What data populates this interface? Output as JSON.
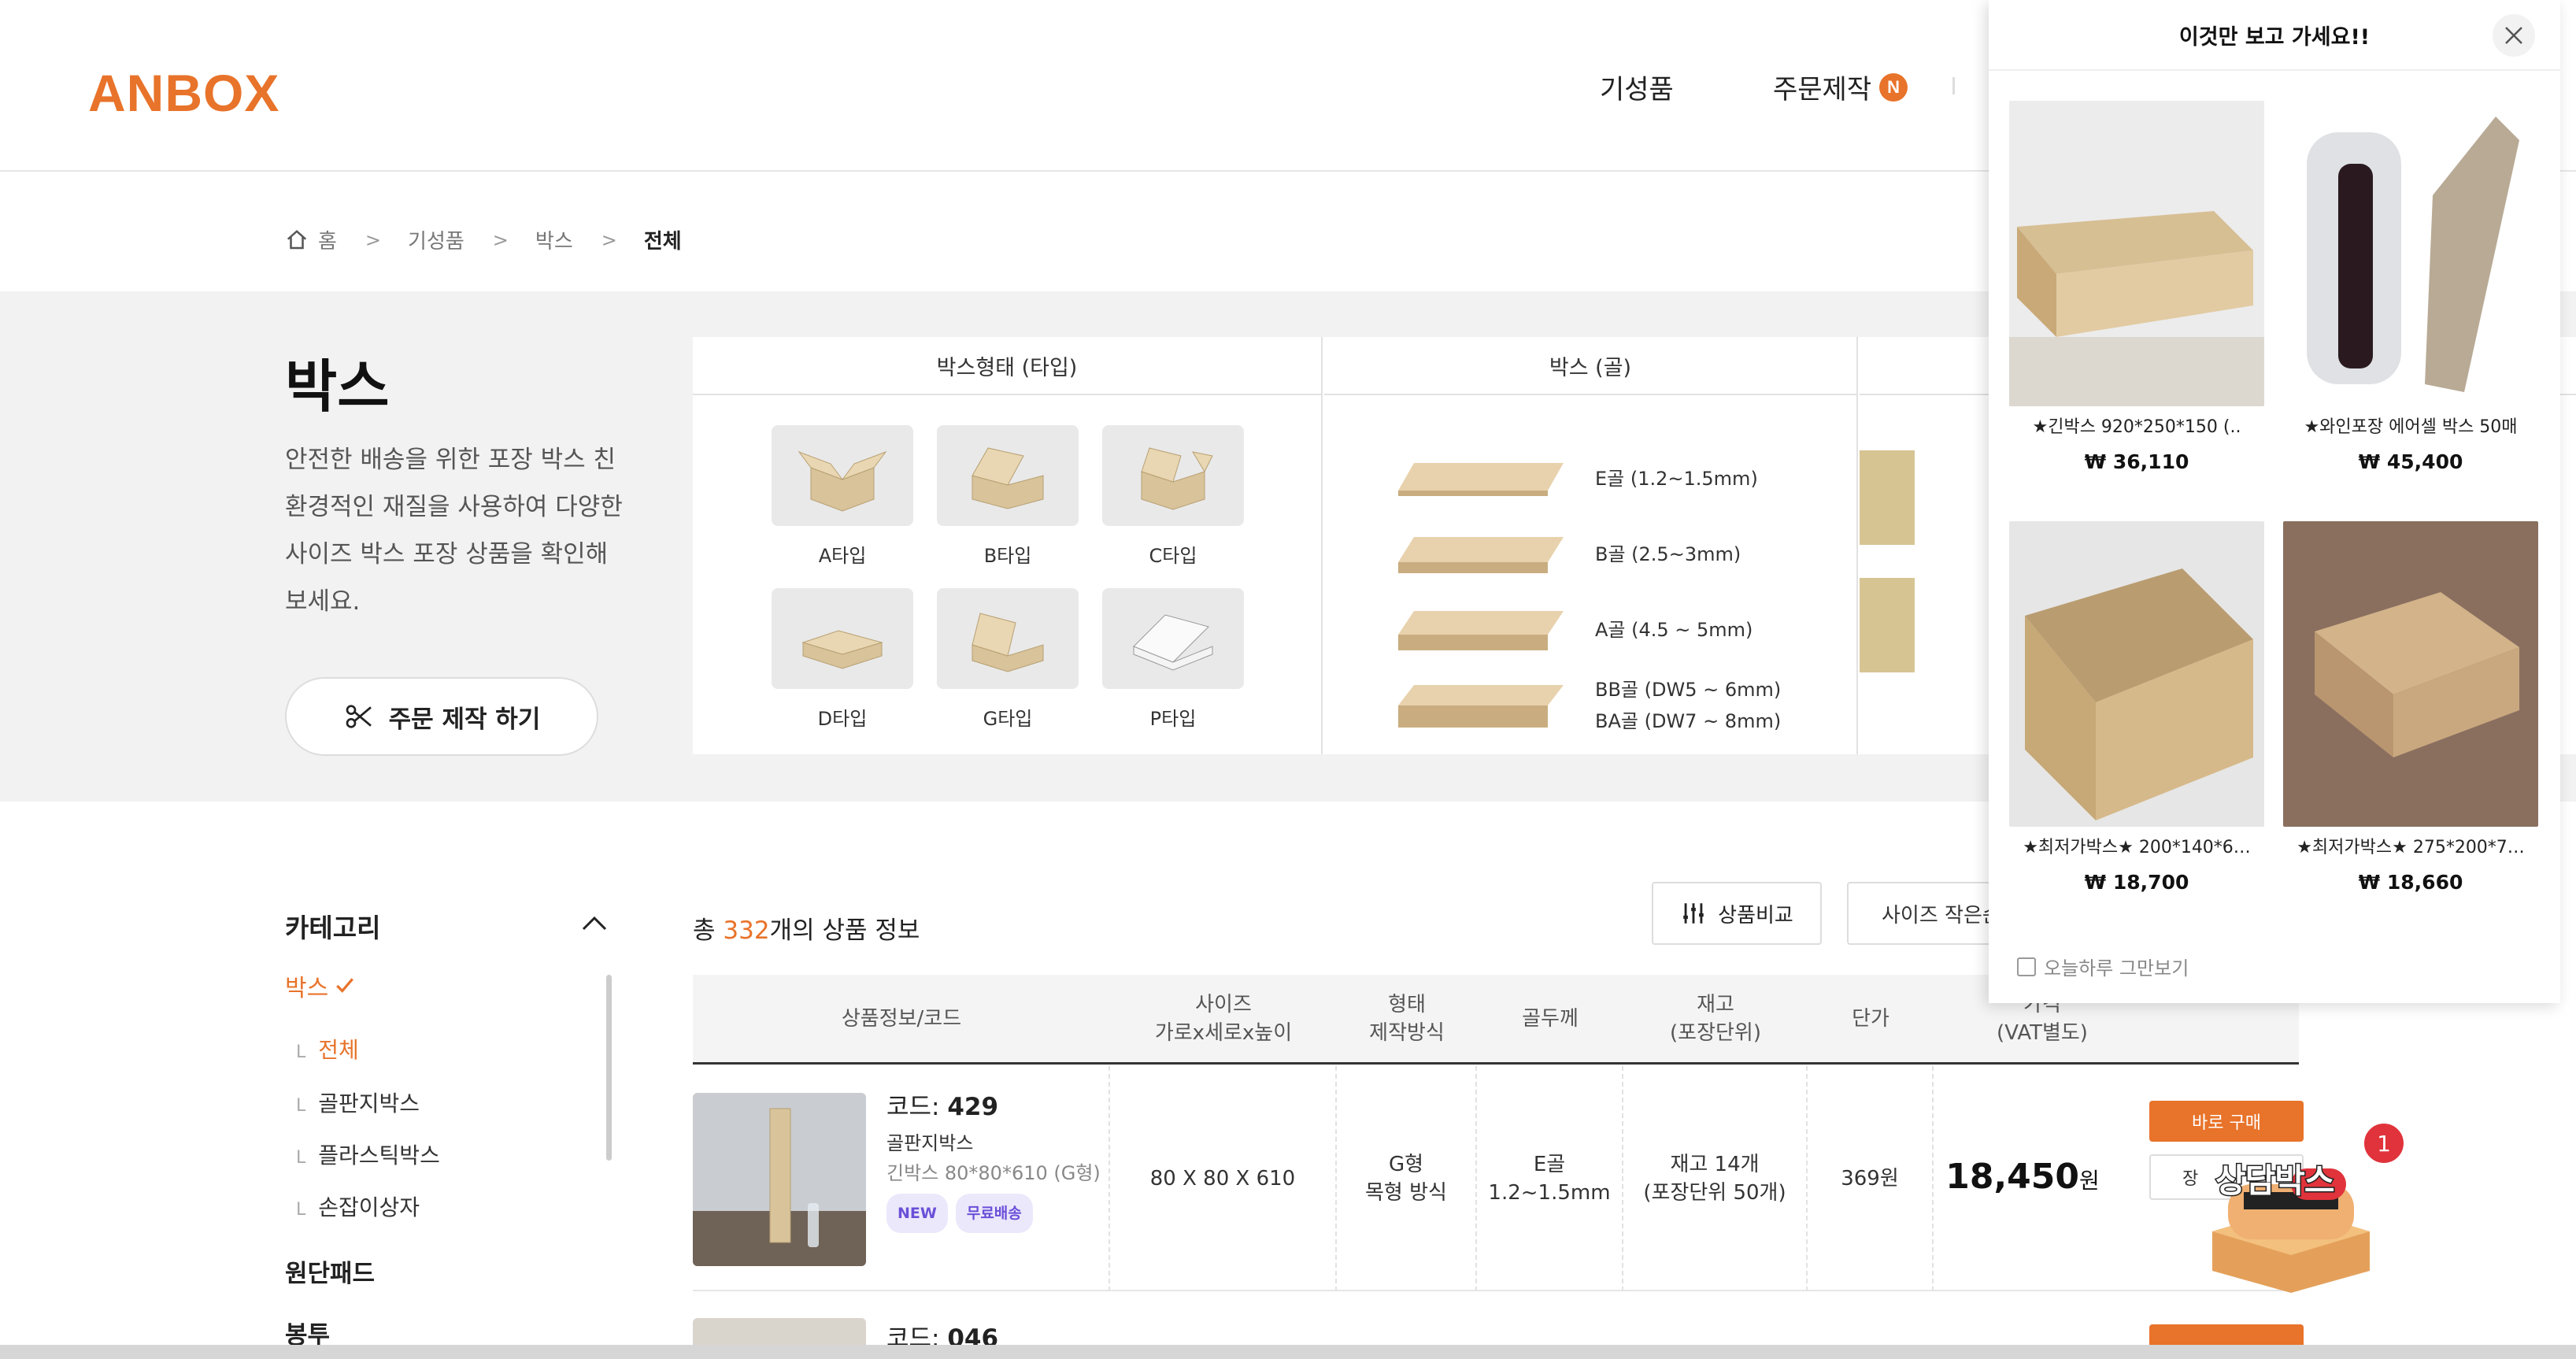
{
  "header": {
    "logo": "ANBOX",
    "nav": [
      {
        "label": "기성품"
      },
      {
        "label": "주문제작",
        "badge": "N"
      }
    ]
  },
  "breadcrumb": {
    "home": "홈",
    "items": [
      "기성품",
      "박스"
    ],
    "current": "전체"
  },
  "hero": {
    "title": "박스",
    "description": "안전한 배송을 위한 포장 박스 친환경적인 재질을 사용하여 다양한 사이즈 박스 포장 상품을 확인해 보세요.",
    "order_button": "주문 제작 하기"
  },
  "box_types": {
    "heading": "박스형태 (타입)",
    "items": [
      "A타입",
      "B타입",
      "C타입",
      "D타입",
      "G타입",
      "P타입"
    ]
  },
  "box_gol": {
    "heading": "박스 (골)",
    "items": [
      "E골 (1.2~1.5mm)",
      "B골 (2.5~3mm)",
      "A골 (4.5 ~ 5mm)",
      "BB골 (DW5 ~ 6mm)",
      "BA골 (DW7 ~ 8mm)"
    ]
  },
  "category": {
    "title": "카테고리",
    "active": "박스",
    "subs": [
      "전체",
      "골판지박스",
      "플라스틱박스",
      "손잡이상자"
    ],
    "mains": [
      "원단패드",
      "봉투"
    ]
  },
  "listing": {
    "total_prefix": "총 ",
    "total_count": "332",
    "total_suffix": "개의 상품 정보",
    "compare_button": "상품비교",
    "sort_button": "사이즈 작은순",
    "columns": {
      "info": "상품정보/코드",
      "size_1": "사이즈",
      "size_2": "가로x세로x높이",
      "form_1": "형태",
      "form_2": "제작방식",
      "gol": "골두께",
      "stock_1": "재고",
      "stock_2": "(포장단위)",
      "unit": "단가",
      "price_1": "가격",
      "price_2": "(VAT별도)"
    },
    "rows": [
      {
        "code_label": "코드: ",
        "code": "429",
        "category": "골판지박스",
        "name": "긴박스 80*80*610 (G형)",
        "badges": [
          "NEW",
          "무료배송"
        ],
        "size": "80 X 80 X 610",
        "form_1": "G형",
        "form_2": "목형 방식",
        "gol_1": "E골",
        "gol_2": "1.2~1.5mm",
        "stock_1": "재고 14개",
        "stock_2": "(포장단위 50개)",
        "unit_price": "369원",
        "price": "18,450",
        "price_unit": "원",
        "buy_button": "바로 구매",
        "cart_button": "장"
      },
      {
        "code_label": "코드: ",
        "code": "046"
      }
    ]
  },
  "chat": {
    "label": "상담박스",
    "badge": "1"
  },
  "popup": {
    "title": "이것만 보고 가세요!!",
    "items": [
      {
        "name": "★긴박스 920*250*150 (..",
        "price": "₩ 36,110"
      },
      {
        "name": "★와인포장 에어셀 박스 50매",
        "price": "₩ 45,400"
      },
      {
        "name": "★최저가박스★ 200*140*6…",
        "price": "₩ 18,700"
      },
      {
        "name": "★최저가박스★ 275*200*7…",
        "price": "₩ 18,660"
      }
    ],
    "dismiss": "오늘하루 그만보기"
  },
  "colors": {
    "accent": "#e8732a",
    "badge_purple": "#6a4fd8",
    "chat_badge": "#e0333b"
  }
}
